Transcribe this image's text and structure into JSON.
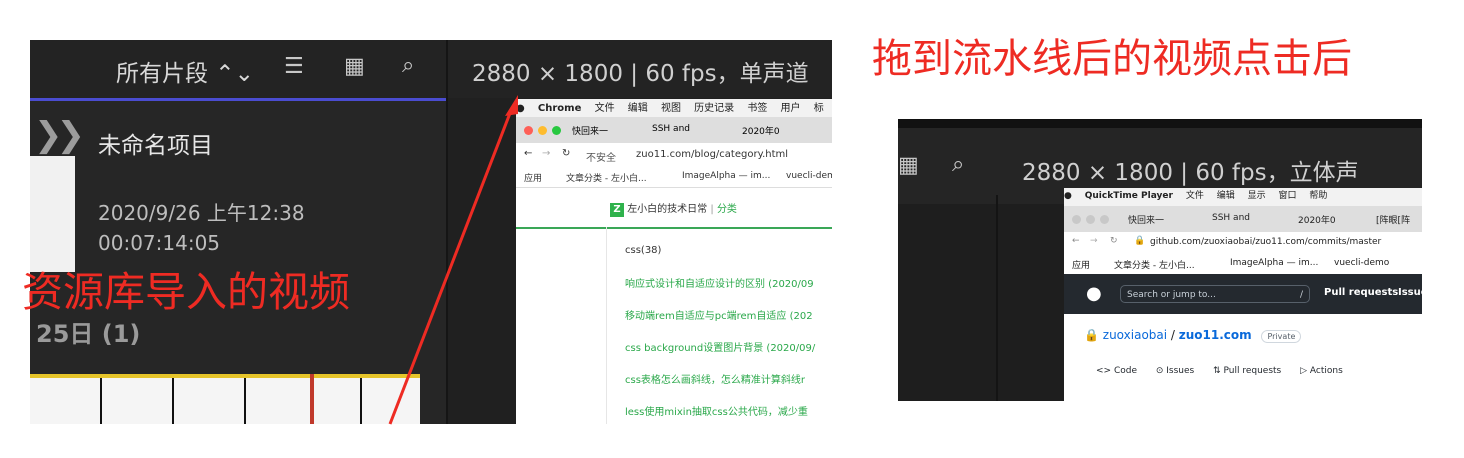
{
  "left_panel": {
    "filter_label": "所有片段 ⌃⌄",
    "project_title": "未命名项目",
    "date": "2020/9/26 上午12:38",
    "duration": "00:07:14:05",
    "group_label": "25日 (1)",
    "viewer_format": "2880 × 1800 | 60 fps，单声道"
  },
  "chrome_window": {
    "menubar": [
      "Chrome",
      "文件",
      "编辑",
      "视图",
      "历史记录",
      "书签",
      "用户",
      "标"
    ],
    "tabs": [
      "快回来一",
      "SSH and",
      "2020年0"
    ],
    "url_security": "不安全",
    "url": "zuo11.com/blog/category.html",
    "bookmarks": [
      "应用",
      "文章分类 - 左小白...",
      "ImageAlpha — im...",
      "vuecli-demo"
    ],
    "blog_title": "左小白的技术日常",
    "blog_section": "分类",
    "category": "css(38)",
    "posts": [
      "响应式设计和自适应设计的区别 (2020/09",
      "移动端rem自适应与pc端rem自适应 (202",
      "css background设置图片背景 (2020/09/",
      "css表格怎么画斜线，怎么精准计算斜线r",
      "less使用mixin抽取css公共代码，减少重"
    ]
  },
  "right_panel": {
    "viewer_format": "2880 × 1800 | 60 fps，立体声",
    "menubar": [
      "QuickTime Player",
      "文件",
      "编辑",
      "显示",
      "窗口",
      "帮助"
    ],
    "tabs": [
      "快回来一",
      "SSH and",
      "2020年0",
      "[阵眼[阵"
    ],
    "url": "github.com/zuoxiaobai/zuo11.com/commits/master",
    "bookmarks": [
      "应用",
      "文章分类 - 左小白...",
      "ImageAlpha — im...",
      "vuecli-demo"
    ],
    "search_placeholder": "Search or jump to...",
    "search_key": "/",
    "nav_pull_requests": "Pull requests",
    "nav_issues": "Issue",
    "repo_owner": "zuoxiaobai",
    "repo_sep": " / ",
    "repo_name": "zuo11.com",
    "repo_visibility": "Private",
    "repo_tabs": [
      "<> Code",
      "⊙ Issues",
      "⇅ Pull requests",
      "▷ Actions"
    ]
  },
  "annotations": {
    "right": "拖到流水线后的视频点击后",
    "left": "资源库导入的视频"
  },
  "colors": {
    "annotation": "#ee2b23",
    "link_green": "#2aa84a",
    "accent_blue": "#4a4cd0"
  }
}
